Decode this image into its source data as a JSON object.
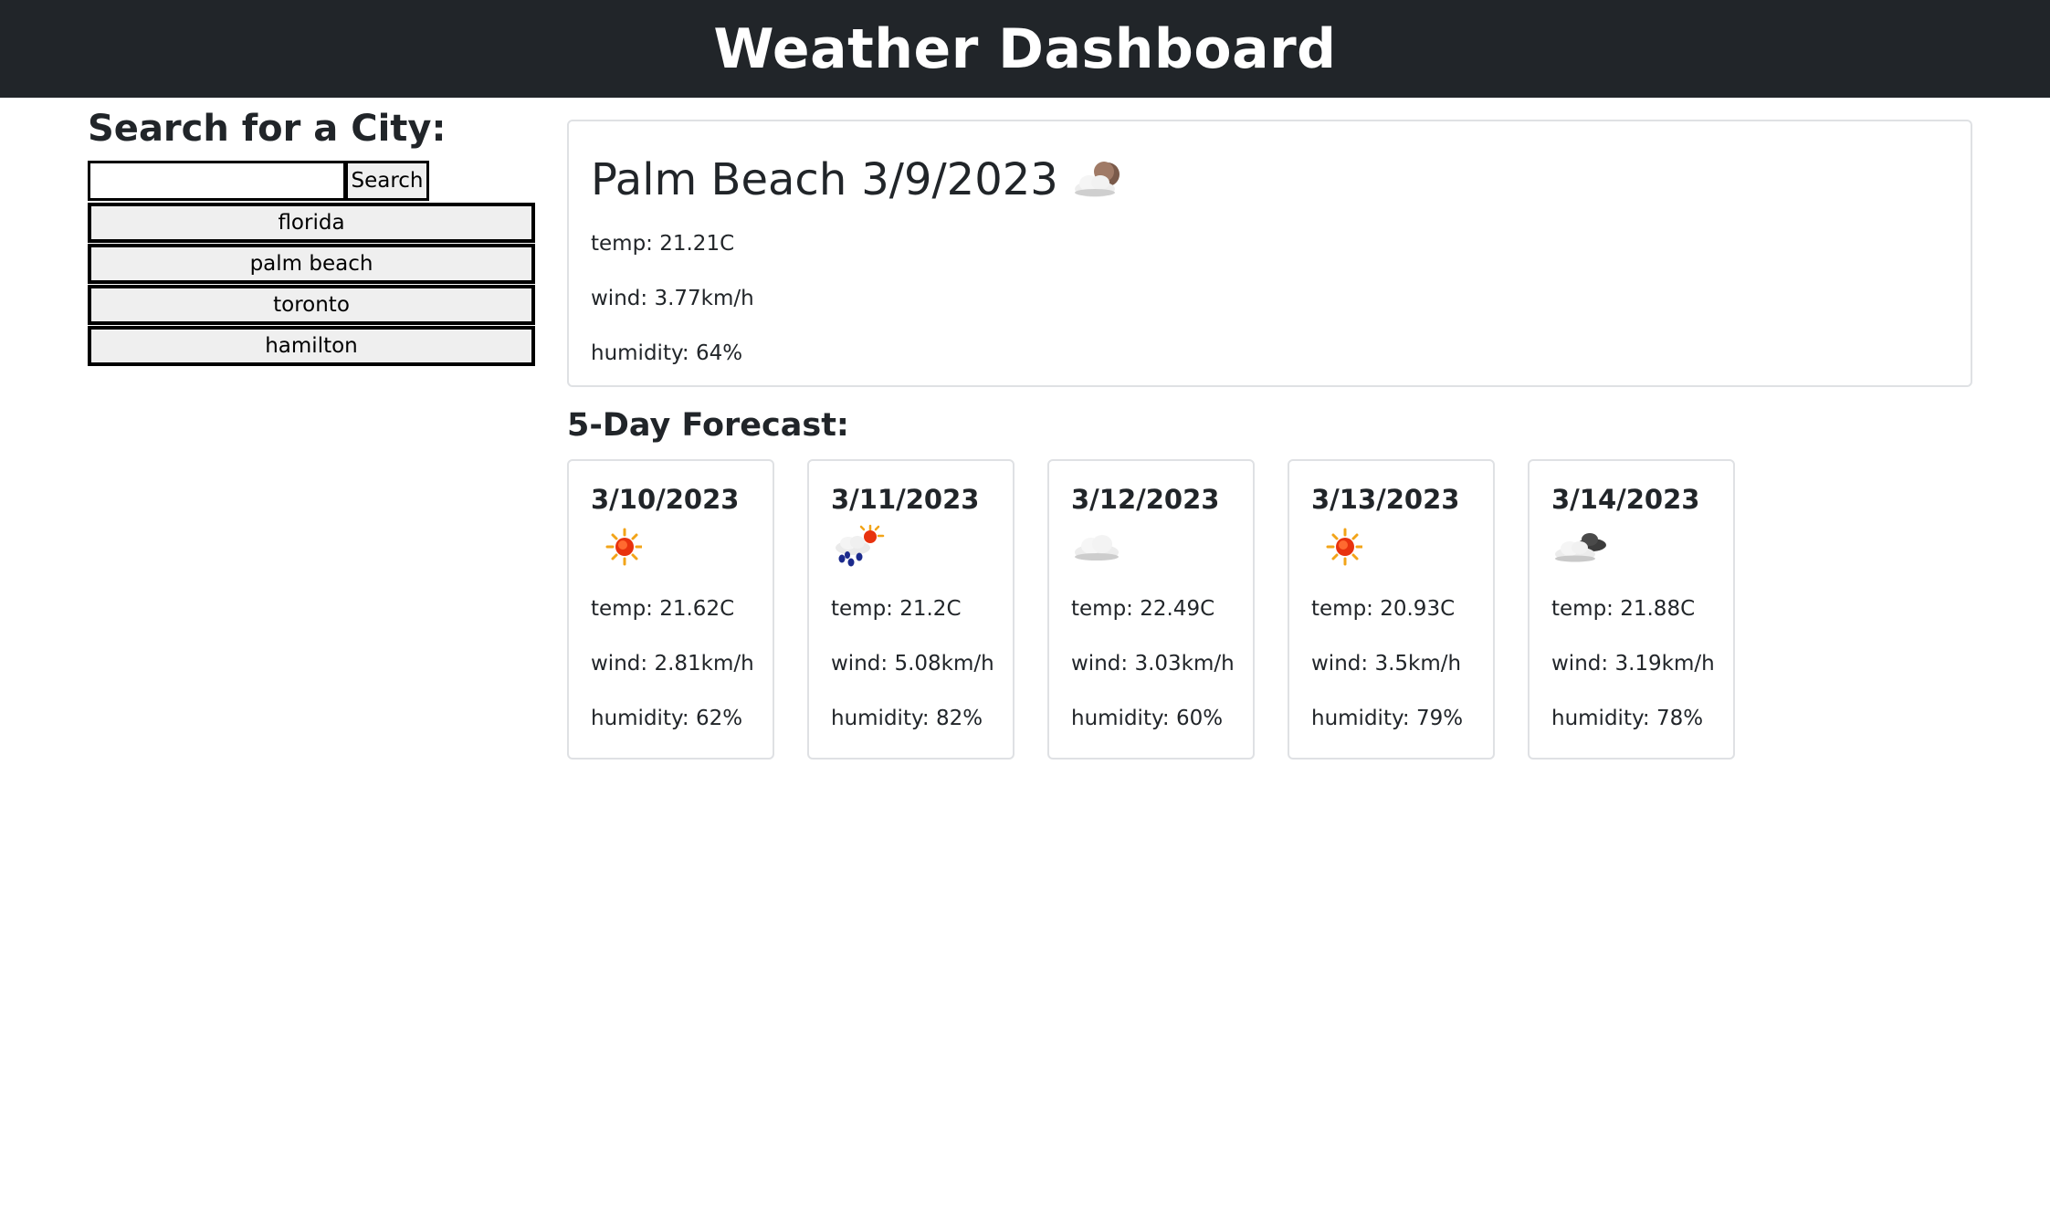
{
  "header": {
    "title": "Weather Dashboard"
  },
  "search": {
    "heading": "Search for a City:",
    "input_value": "",
    "button_label": "Search",
    "history": [
      "florida",
      "palm beach",
      "toronto",
      "hamilton"
    ]
  },
  "current": {
    "city": "Palm Beach",
    "date": "3/9/2023",
    "icon": "moon-cloud-icon",
    "temp": "temp: 21.21C",
    "wind": "wind: 3.77km/h",
    "humidity": "humidity: 64%"
  },
  "forecast": {
    "heading": "5-Day Forecast:",
    "days": [
      {
        "date": "3/10/2023",
        "icon": "sun-icon",
        "temp": "temp: 21.62C",
        "wind": "wind: 2.81km/h",
        "humidity": "humidity: 62%"
      },
      {
        "date": "3/11/2023",
        "icon": "sun-rain-cloud-icon",
        "temp": "temp: 21.2C",
        "wind": "wind: 5.08km/h",
        "humidity": "humidity: 82%"
      },
      {
        "date": "3/12/2023",
        "icon": "cloud-icon",
        "temp": "temp: 22.49C",
        "wind": "wind: 3.03km/h",
        "humidity": "humidity: 60%"
      },
      {
        "date": "3/13/2023",
        "icon": "sun-icon",
        "temp": "temp: 20.93C",
        "wind": "wind: 3.5km/h",
        "humidity": "humidity: 79%"
      },
      {
        "date": "3/14/2023",
        "icon": "dark-clouds-icon",
        "temp": "temp: 21.88C",
        "wind": "wind: 3.19km/h",
        "humidity": "humidity: 78%"
      }
    ]
  },
  "colors": {
    "header_bg": "#212529",
    "card_border": "#dfe1e4",
    "button_bg": "#efefef"
  }
}
